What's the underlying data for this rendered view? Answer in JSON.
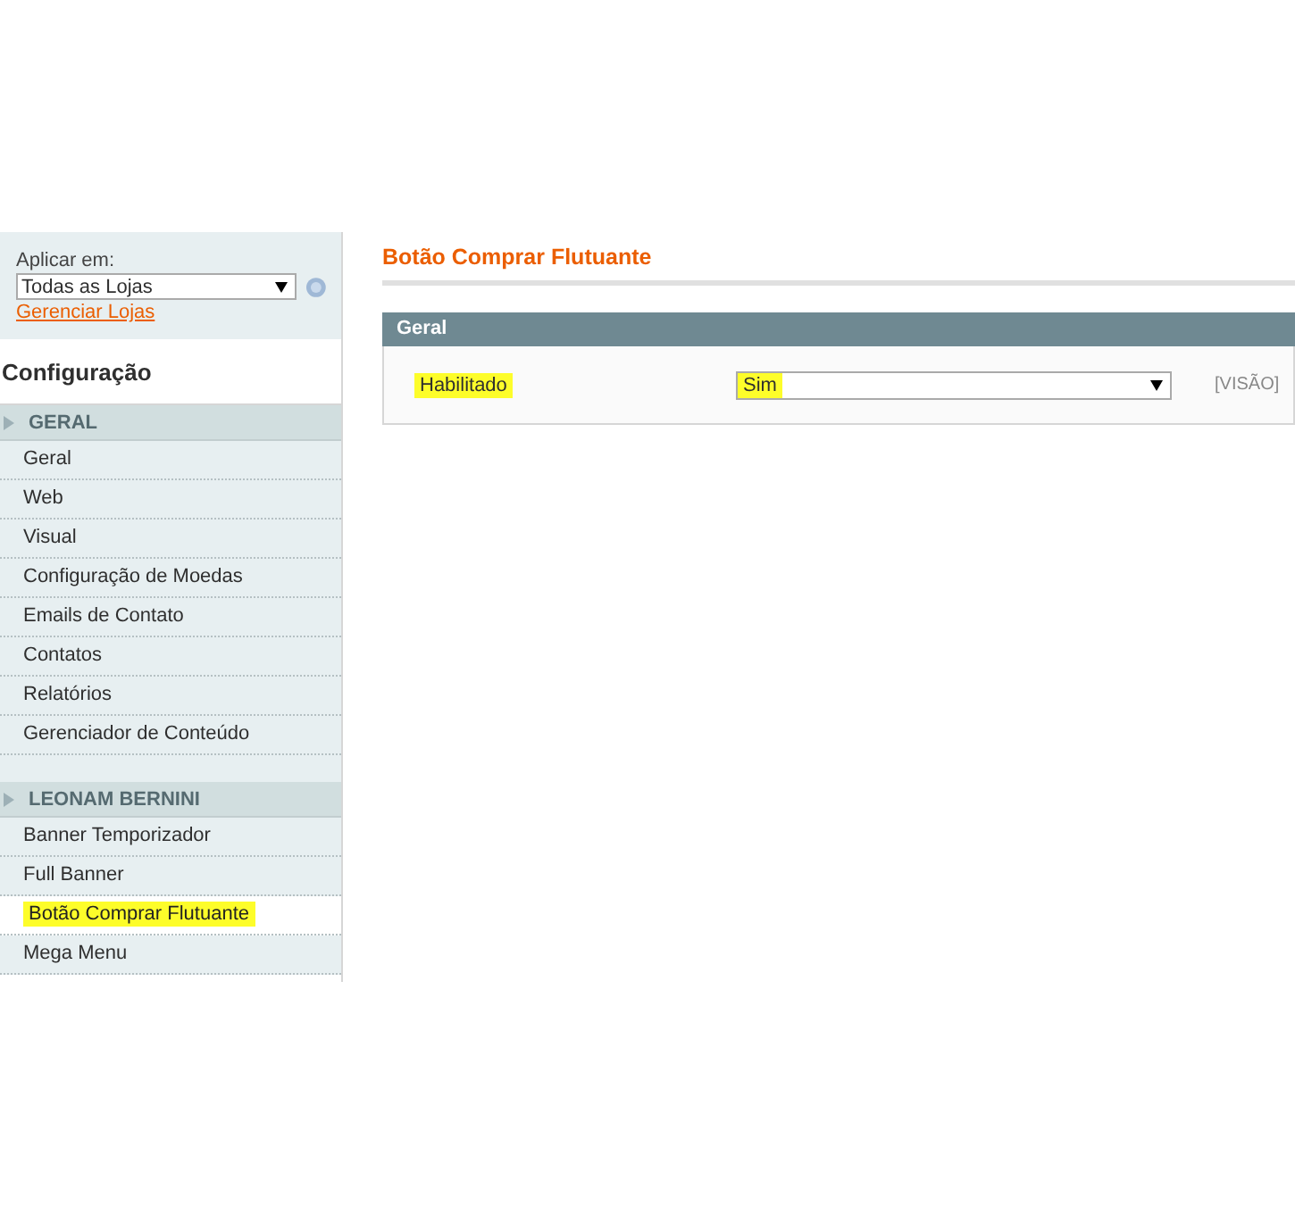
{
  "store_switcher": {
    "label": "Aplicar em:",
    "value": "Todas as Lojas",
    "link": "Gerenciar Lojas"
  },
  "sidebar": {
    "title": "Configuração",
    "sections": [
      {
        "title": "GERAL",
        "items": [
          {
            "label": "Geral",
            "selected": false
          },
          {
            "label": "Web",
            "selected": false
          },
          {
            "label": "Visual",
            "selected": false
          },
          {
            "label": "Configuração de Moedas",
            "selected": false
          },
          {
            "label": "Emails de Contato",
            "selected": false
          },
          {
            "label": "Contatos",
            "selected": false
          },
          {
            "label": "Relatórios",
            "selected": false
          },
          {
            "label": "Gerenciador de Conteúdo",
            "selected": false
          }
        ]
      },
      {
        "title": "LEONAM BERNINI",
        "items": [
          {
            "label": "Banner Temporizador",
            "selected": false
          },
          {
            "label": "Full Banner",
            "selected": false
          },
          {
            "label": "Botão Comprar Flutuante",
            "selected": true
          },
          {
            "label": "Mega Menu",
            "selected": false
          }
        ]
      }
    ]
  },
  "page": {
    "title": "Botão Comprar Flutuante",
    "fieldset": {
      "title": "Geral",
      "fields": [
        {
          "label": "Habilitado",
          "value": "Sim",
          "scope": "[VISÃO]",
          "highlighted": true
        }
      ]
    }
  }
}
